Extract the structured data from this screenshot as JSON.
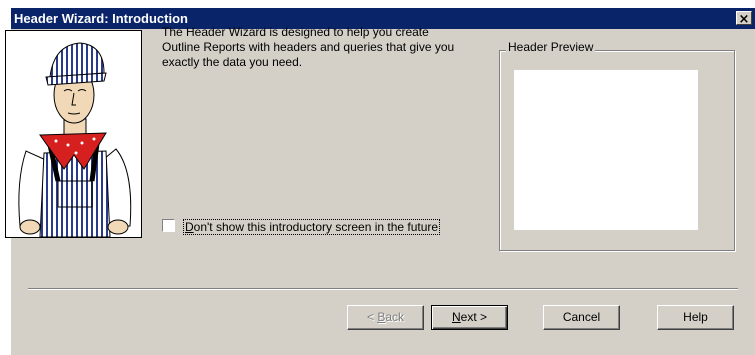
{
  "window": {
    "title": "Header Wizard: Introduction",
    "close_glyph": "×"
  },
  "intro_text": "The Header Wizard is designed to help you create Outline Reports with headers and queries that give you exactly the data you need.",
  "dont_show": {
    "label_accel": "D",
    "label_rest": "on't show this introductory screen in the future",
    "checked": false
  },
  "preview": {
    "title": "Header Preview"
  },
  "buttons": {
    "back": {
      "pre": "< ",
      "accel": "B",
      "post": "ack",
      "enabled": false
    },
    "next": {
      "pre": "",
      "accel": "N",
      "post": "ext >",
      "enabled": true,
      "default": true
    },
    "cancel": {
      "label": "Cancel"
    },
    "help": {
      "label": "Help"
    }
  },
  "colors": {
    "titlebar": "#0a246a",
    "dialog_face": "#d4d0c8",
    "scarf": "#d62020",
    "stripes": "#2b3b8c"
  }
}
